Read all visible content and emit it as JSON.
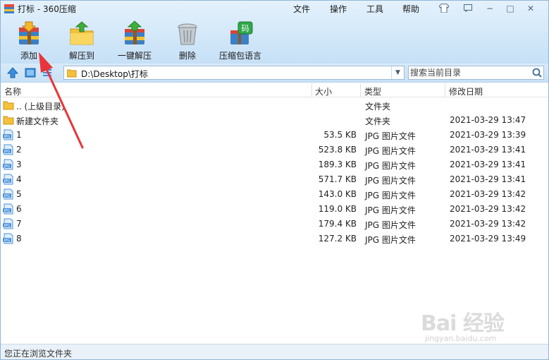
{
  "window": {
    "title": "打标 - 360压缩",
    "menu": [
      "文件",
      "操作",
      "工具",
      "帮助"
    ],
    "controls": {
      "minimize": "−",
      "maximize": "□",
      "close": "✕"
    }
  },
  "toolbar": [
    {
      "label": "添加",
      "icon": "add-archive-icon"
    },
    {
      "label": "解压到",
      "icon": "extract-to-icon"
    },
    {
      "label": "一键解压",
      "icon": "one-click-extract-icon"
    },
    {
      "label": "删除",
      "icon": "trash-icon"
    },
    {
      "label": "压缩包语言",
      "icon": "archive-language-icon"
    }
  ],
  "address": {
    "path": "D:\\Desktop\\打标",
    "search_placeholder": "搜索当前目录"
  },
  "columns": [
    "名称",
    "大小",
    "类型",
    "修改日期"
  ],
  "files": [
    {
      "name": ".. (上级目录)",
      "size": "",
      "type": "文件夹",
      "modified": "",
      "icon": "folder-icon"
    },
    {
      "name": "新建文件夹",
      "size": "",
      "type": "文件夹",
      "modified": "2021-03-29 13:47",
      "icon": "folder-icon"
    },
    {
      "name": "1",
      "size": "53.5 KB",
      "type": "JPG 图片文件",
      "modified": "2021-03-29 13:39",
      "icon": "jpg-file-icon"
    },
    {
      "name": "2",
      "size": "523.8 KB",
      "type": "JPG 图片文件",
      "modified": "2021-03-29 13:41",
      "icon": "jpg-file-icon"
    },
    {
      "name": "3",
      "size": "189.3 KB",
      "type": "JPG 图片文件",
      "modified": "2021-03-29 13:41",
      "icon": "jpg-file-icon"
    },
    {
      "name": "4",
      "size": "571.7 KB",
      "type": "JPG 图片文件",
      "modified": "2021-03-29 13:41",
      "icon": "jpg-file-icon"
    },
    {
      "name": "5",
      "size": "143.0 KB",
      "type": "JPG 图片文件",
      "modified": "2021-03-29 13:42",
      "icon": "jpg-file-icon"
    },
    {
      "name": "6",
      "size": "119.0 KB",
      "type": "JPG 图片文件",
      "modified": "2021-03-29 13:42",
      "icon": "jpg-file-icon"
    },
    {
      "name": "7",
      "size": "179.4 KB",
      "type": "JPG 图片文件",
      "modified": "2021-03-29 13:42",
      "icon": "jpg-file-icon"
    },
    {
      "name": "8",
      "size": "127.2 KB",
      "type": "JPG 图片文件",
      "modified": "2021-03-29 13:49",
      "icon": "jpg-file-icon"
    }
  ],
  "status": "您正在浏览文件夹",
  "watermark": {
    "text": "Bai 经验",
    "sub": "jingyan.baidu.com"
  },
  "colors": {
    "annotation_arrow": "#e8353a",
    "folder": "#f3c13a",
    "jpg_icon": "#4a90d9"
  }
}
